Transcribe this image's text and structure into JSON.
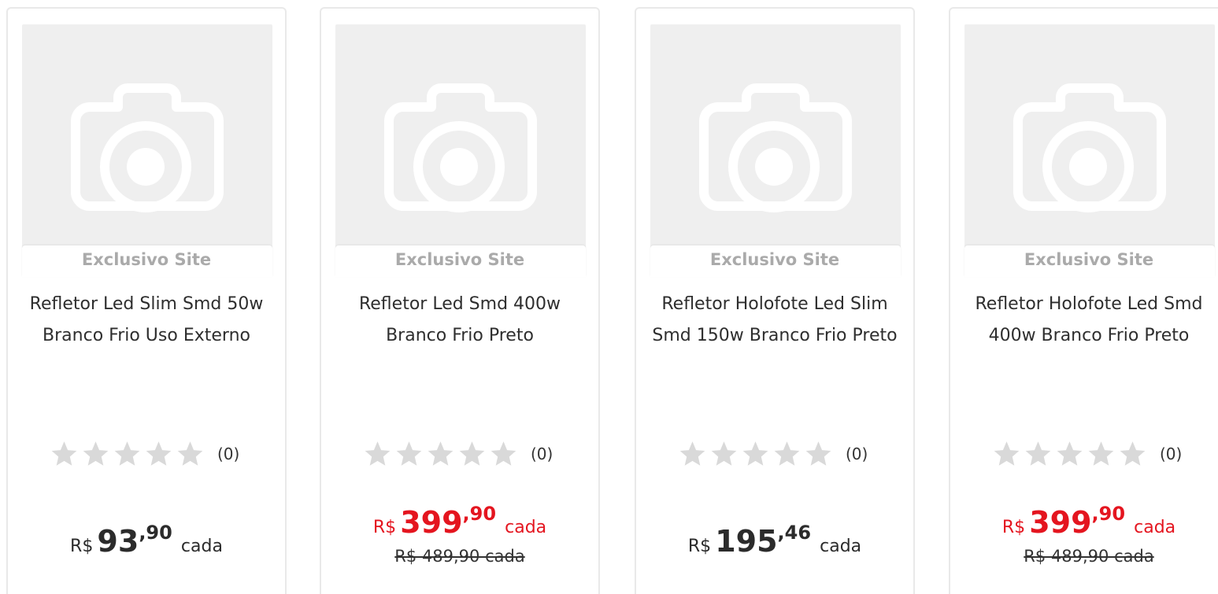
{
  "products": [
    {
      "badge": "Exclusivo Site",
      "title": "Refletor Led Slim Smd 50w Branco Frio Uso Externo",
      "rating_count": "(0)",
      "rating_value": 0,
      "price": {
        "currency": "R$",
        "int": "93",
        "dec": ",90",
        "unit": "cada",
        "sale": false
      },
      "old_price": ""
    },
    {
      "badge": "Exclusivo Site",
      "title": "Refletor Led Smd 400w Branco Frio Preto",
      "rating_count": "(0)",
      "rating_value": 0,
      "price": {
        "currency": "R$",
        "int": "399",
        "dec": ",90",
        "unit": "cada",
        "sale": true
      },
      "old_price": "R$ 489,90 cada"
    },
    {
      "badge": "Exclusivo Site",
      "title": "Refletor Holofote Led Slim Smd 150w Branco Frio Preto",
      "rating_count": "(0)",
      "rating_value": 0,
      "price": {
        "currency": "R$",
        "int": "195",
        "dec": ",46",
        "unit": "cada",
        "sale": false
      },
      "old_price": ""
    },
    {
      "badge": "Exclusivo Site",
      "title": "Refletor Holofote Led Smd 400w Branco Frio Preto",
      "rating_count": "(0)",
      "rating_value": 0,
      "price": {
        "currency": "R$",
        "int": "399",
        "dec": ",90",
        "unit": "cada",
        "sale": true
      },
      "old_price": "R$ 489,90 cada"
    }
  ],
  "icons": {
    "placeholder": "camera-icon",
    "rating": "star-icon"
  },
  "colors": {
    "sale_price": "#e4151f",
    "star_empty": "#d9d9d9",
    "placeholder_bg": "#efefef"
  }
}
